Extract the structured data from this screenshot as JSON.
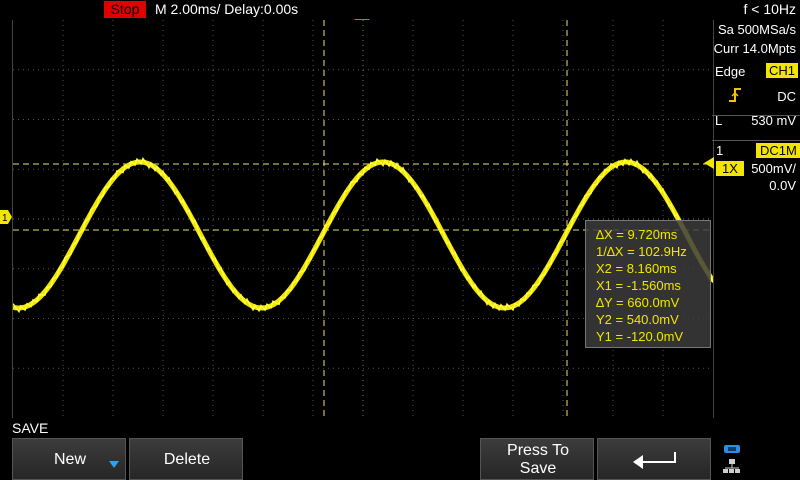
{
  "topbar": {
    "run_state": "Stop",
    "timebase": "M 2.00ms/ Delay:0.00s",
    "frequency": "f < 10Hz"
  },
  "acquisition": {
    "sample_rate": "Sa 500MSa/s",
    "memory_depth": "Curr 14.0Mpts"
  },
  "trigger": {
    "type": "Edge",
    "source": "CH1",
    "coupling": "DC",
    "level_label": "L",
    "level": "530 mV"
  },
  "channel": {
    "number": "1",
    "coupling": "DC1M",
    "probe": "1X",
    "scale": "500mV/",
    "offset": "0.0V",
    "marker": "1"
  },
  "cursors": {
    "dx": "∆X = 9.720ms",
    "inv_dx": "1/∆X = 102.9Hz",
    "x2": "X2 = 8.160ms",
    "x1": "X1 = -1.560ms",
    "dy": "∆Y = 660.0mV",
    "y2": "Y2 = 540.0mV",
    "y1": "Y1 = -120.0mV"
  },
  "menu": {
    "title": "SAVE",
    "new": "New",
    "delete": "Delete",
    "press_to_save": "Press To Save"
  },
  "colors": {
    "channel1": "#f2e600",
    "stop": "#e00000",
    "trigger_marker": "#1e9be6"
  },
  "icons": {
    "back": "return-arrow-icon",
    "network": "network-icon",
    "trigger_edge": "rising-edge-icon"
  }
}
